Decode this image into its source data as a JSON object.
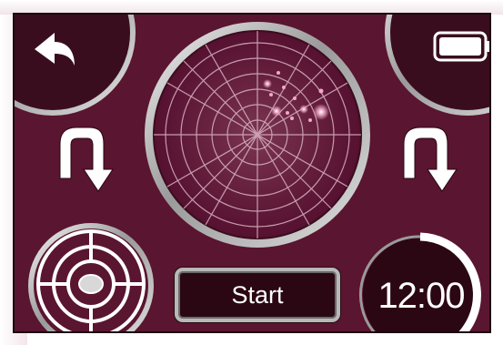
{
  "start_button": {
    "label": "Start"
  },
  "clock": {
    "time": "12:00"
  },
  "icons": {
    "back": "back-arrow-icon",
    "battery": "battery-icon",
    "left_turn": "u-turn-down-arrow-icon",
    "right_turn": "u-turn-down-arrow-icon",
    "target": "target-crosshair-icon",
    "radar": "radar-display"
  },
  "colors": {
    "screen_background": "#5a1530",
    "icon": "#ffffff",
    "bezel": "#c8c8c8",
    "radar_blip": "#f2a9c9"
  }
}
